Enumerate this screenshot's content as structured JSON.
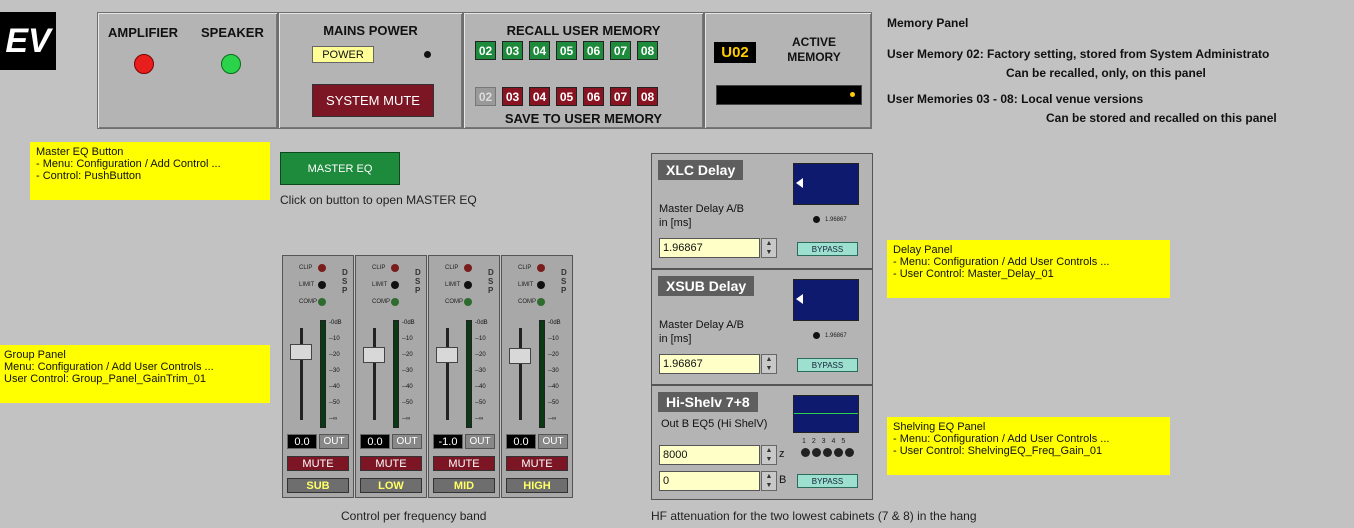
{
  "logo": {
    "text": "EV"
  },
  "amp": {
    "amplifier_label": "AMPLIFIER",
    "speaker_label": "SPEAKER",
    "amp_led_color": "#e81e1e",
    "spk_led_color": "#2ad34a"
  },
  "mains": {
    "title": "MAINS POWER",
    "power_label": "POWER",
    "mute_label": "SYSTEM MUTE"
  },
  "recall": {
    "title": "RECALL USER MEMORY",
    "slots": [
      "02",
      "03",
      "04",
      "05",
      "06",
      "07",
      "08"
    ]
  },
  "save": {
    "title": "SAVE TO USER MEMORY",
    "slots": [
      "02",
      "03",
      "04",
      "05",
      "06",
      "07",
      "08"
    ]
  },
  "active": {
    "value": "U02",
    "label": "ACTIVE MEMORY"
  },
  "memory_info": {
    "title": "Memory Panel",
    "line1": "User Memory 02: Factory setting, stored from System Administrato",
    "line2": "Can be recalled, only, on this panel",
    "line3": "User Memories 03 - 08: Local venue versions",
    "line4": "Can be stored and recalled on this panel"
  },
  "master_eq": {
    "button_label": "MASTER EQ",
    "caption": "Click on button to open MASTER EQ"
  },
  "notes": {
    "master_eq": [
      "Master EQ Button",
      "- Menu: Configuration / Add Control ...",
      "- Control: PushButton"
    ],
    "group": [
      "Group Panel",
      " Menu: Configuration / Add User Controls ...",
      " User Control: Group_Panel_GainTrim_01"
    ],
    "delay": [
      "Delay Panel",
      "- Menu: Configuration / Add User Controls ...",
      "- User Control: Master_Delay_01"
    ],
    "shelving": [
      "Shelving EQ Panel",
      "- Menu: Configuration / Add User Controls ...",
      "- User Control: ShelvingEQ_Freq_Gain_01"
    ]
  },
  "strips": [
    {
      "band": "SUB",
      "gain": "0.0"
    },
    {
      "band": "LOW",
      "gain": "0.0"
    },
    {
      "band": "MID",
      "gain": "-1.0"
    },
    {
      "band": "HIGH",
      "gain": "0.0"
    }
  ],
  "strip_common": {
    "clip": "CLIP",
    "limit": "LIMIT",
    "comp": "COMP",
    "out": "OUT",
    "mute": "MUTE",
    "dsp": "DSP",
    "scale": [
      "-0dB",
      "--10",
      "--20",
      "--30",
      "--40",
      "--50",
      "--∞"
    ]
  },
  "group_caption": "Control per frequency band",
  "xlc": {
    "title": "XLC Delay",
    "desc1": "Master Delay A/B",
    "desc2": "in [ms]",
    "value": "1.96867",
    "readout": "1.96867",
    "bypass": "BYPASS"
  },
  "xsub": {
    "title": "XSUB Delay",
    "desc1": "Master Delay A/B",
    "desc2": "in [ms]",
    "value": "1.96867",
    "readout": "1.96867",
    "bypass": "BYPASS"
  },
  "shelf": {
    "title": "Hi-Shelv 7+8",
    "desc": "Out B EQ5 (Hi ShelV)",
    "freq": "8000",
    "gain": "0",
    "unit_hz": "z",
    "unit_db": "B",
    "bypass": "BYPASS",
    "bands": "1 2 3 4 5"
  },
  "delay_caption": "HF attenuation for the two lowest cabinets (7 & 8) in the hang"
}
